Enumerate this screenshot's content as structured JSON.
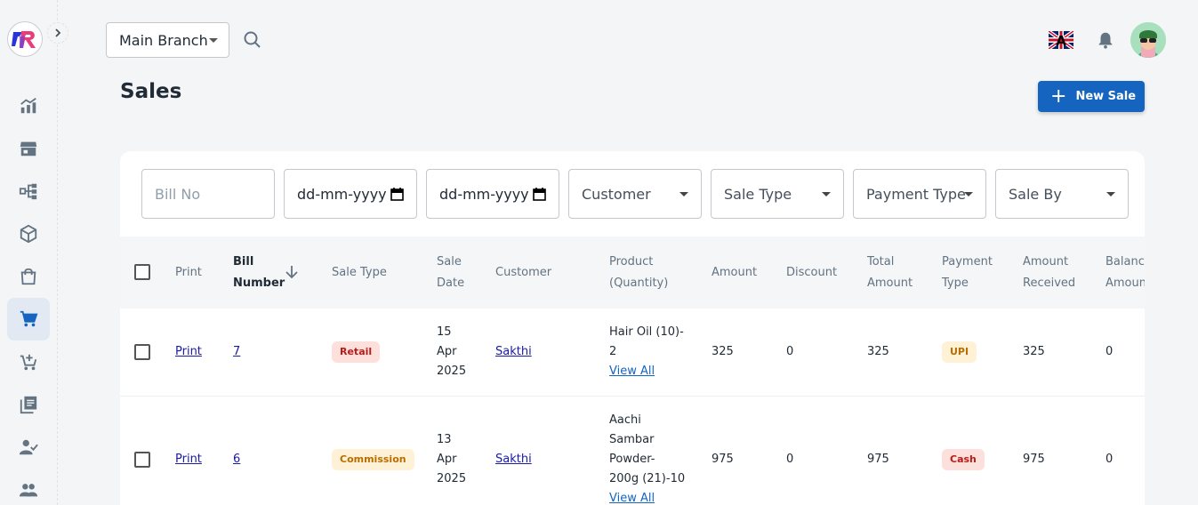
{
  "header": {
    "branch": "Main Branch",
    "flag_letter": "A"
  },
  "page": {
    "title": "Sales",
    "new_sale_label": "New Sale"
  },
  "filters": {
    "bill_no_placeholder": "Bill No",
    "date_from": "dd-mm-yyyy",
    "date_to": "dd-mm-yyyy",
    "customer": "Customer",
    "sale_type": "Sale Type",
    "payment_type": "Payment Type",
    "sale_by": "Sale By"
  },
  "table": {
    "columns": {
      "print": "Print",
      "bill_number_1": "Bill",
      "bill_number_2": "Number",
      "sale_type": "Sale Type",
      "sale_date_1": "Sale",
      "sale_date_2": "Date",
      "customer": "Customer",
      "product_1": "Product",
      "product_2": "(Quantity)",
      "amount": "Amount",
      "discount": "Discount",
      "total_1": "Total",
      "total_2": "Amount",
      "payment_1": "Payment",
      "payment_2": "Type",
      "received_1": "Amount",
      "received_2": "Received",
      "balance_1": "Balance",
      "balance_2": "Amount"
    },
    "rows": [
      {
        "print": "Print",
        "bill_number": "7",
        "sale_type": "Retail",
        "date_day": "15",
        "date_month": "Apr",
        "date_year": "2025",
        "customer": "Sakthi",
        "product_line1": "Hair Oil (10)-",
        "product_line2": "2",
        "view_all": "View All",
        "amount": "325",
        "discount": "0",
        "total": "325",
        "payment_type": "UPI",
        "received": "325",
        "balance": "0"
      },
      {
        "print": "Print",
        "bill_number": "6",
        "sale_type": "Commission",
        "date_day": "13",
        "date_month": "Apr",
        "date_year": "2025",
        "customer": "Sakthi",
        "product_line1": "Aachi",
        "product_line2": "Sambar",
        "product_line3": "Powder-",
        "product_line4": "200g (21)-10",
        "view_all": "View All",
        "amount": "975",
        "discount": "0",
        "total": "975",
        "payment_type": "Cash",
        "received": "975",
        "balance": "0"
      }
    ]
  },
  "colors": {
    "primary": "#1565c0",
    "active_nav_bg": "#e3e9f2",
    "icon": "#637381"
  }
}
